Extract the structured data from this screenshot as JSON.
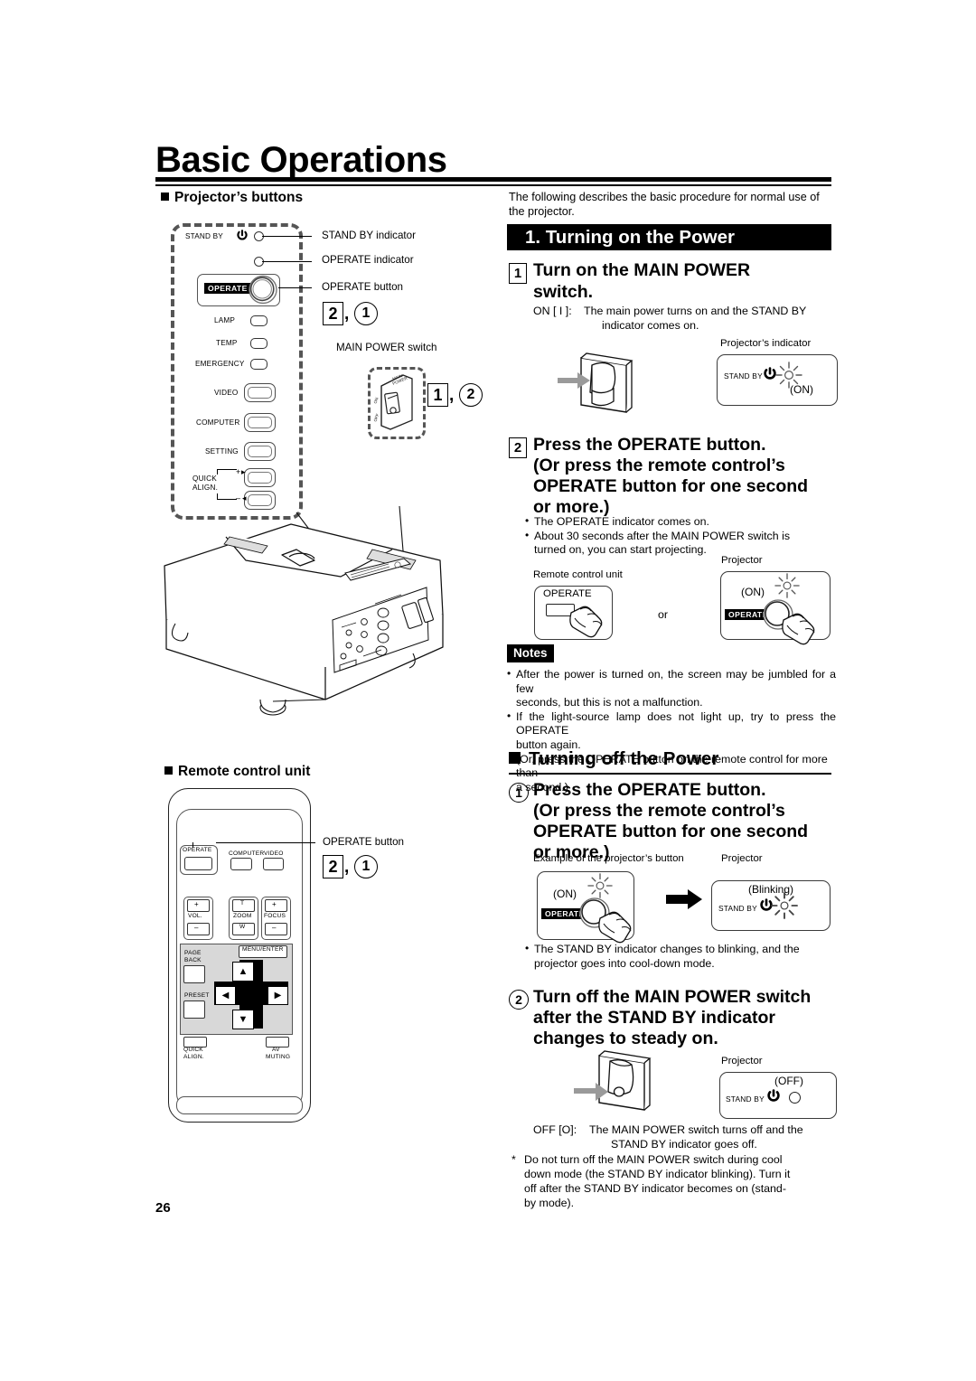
{
  "page": {
    "title": "Basic Operations",
    "number": "26"
  },
  "left_column": {
    "section1_heading": "Projector’s buttons",
    "callouts": {
      "standby_indicator": "STAND BY indicator",
      "operate_indicator": "OPERATE indicator",
      "operate_button": "OPERATE button",
      "main_power_switch": "MAIN POWER switch"
    },
    "panel": {
      "standby_label": "STAND BY",
      "operate_label": "OPERATE",
      "indicators": [
        "LAMP",
        "TEMP",
        "EMERGENCY"
      ],
      "source_buttons": [
        "VIDEO",
        "COMPUTER",
        "SETTING"
      ],
      "quick_align_label_line1": "QUICK",
      "quick_align_label_line2": "ALIGN.",
      "quick_align_plus": "+",
      "quick_align_minus": "–"
    },
    "step_marks": {
      "panel_operate": {
        "box": "2",
        "circle": "1"
      },
      "main_power": {
        "box": "1",
        "circle": "2"
      },
      "remote_operate": {
        "box": "2",
        "circle": "1"
      }
    },
    "main_power_switch_art": {
      "top_label": "MAIN POWER",
      "on_label": "ON",
      "off_label": "OFF"
    },
    "section2_heading": "Remote control unit",
    "remote": {
      "operate": "OPERATE",
      "computer": "COMPUTER",
      "video": "VIDEO",
      "vol": "VOL.",
      "vol_plus": "+",
      "vol_minus": "–",
      "zoom": "ZOOM",
      "zoom_t": "T",
      "zoom_w": "W",
      "focus": "FOCUS",
      "focus_plus": "+",
      "focus_minus": "–",
      "page_back_line1": "PAGE",
      "page_back_line2": "BACK",
      "menu_enter": "MENU/ENTER",
      "preset": "PRESET",
      "quick_align_line1": "QUICK",
      "quick_align_line2": "ALIGN.",
      "av_muting_line1": "AV",
      "av_muting_line2": "MUTING",
      "arrow_up": "▲",
      "arrow_down": "▼",
      "arrow_left": "◀",
      "arrow_right": "▶"
    },
    "remote_callout": "OPERATE button"
  },
  "right_column": {
    "intro_line1": "The following describes the basic procedure for normal use of",
    "intro_line2": "the projector.",
    "section_on": {
      "bar_title": "1. Turning on the Power",
      "step1": {
        "num": "1",
        "heading_line1": "Turn on the MAIN POWER",
        "heading_line2": "switch.",
        "desc_bold": "ON [ I ]:",
        "desc_line1": "The main power turns on and the STAND BY",
        "desc_line2": "indicator comes on."
      },
      "indicator_art": {
        "caption": "Projector’s indicator",
        "standby_label": "STAND BY",
        "state": "(ON)"
      },
      "step2": {
        "num": "2",
        "heading_line1": "Press the OPERATE button.",
        "heading_line2": "(Or press the remote control’s",
        "heading_line3": "OPERATE button for one second",
        "heading_line4": "or more.)",
        "bullet1": "The OPERATE indicator comes on.",
        "bullet2_line1": "About 30 seconds after the MAIN POWER switch is",
        "bullet2_line2": "turned on, you can start projecting."
      },
      "press_art": {
        "remote_caption": "Remote control unit",
        "remote_button": "OPERATE",
        "or": "or",
        "projector_caption": "Projector",
        "projector_state": "(ON)",
        "projector_button": "OPERATE"
      },
      "notes": {
        "tag": "Notes",
        "n1_line1": "After the power is turned on, the screen may be jumbled for a few",
        "n1_line2": "seconds, but this is not a malfunction.",
        "n2_line1": "If the light-source lamp does not light up, try to press the OPERATE",
        "n2_line2": "button again.",
        "n2_line3": "(Or, press the OPERATE button on the remote control for more than",
        "n2_line4": "a second.)"
      }
    },
    "section_off": {
      "heading": "Turning off the Power",
      "step1": {
        "num": "1",
        "heading_line1": "Press the OPERATE button.",
        "heading_line2": "(Or press the remote control’s",
        "heading_line3": "OPERATE button for one second",
        "heading_line4": "or more.)"
      },
      "art": {
        "caption_left": "Example of the projector’s button",
        "caption_right": "Projector",
        "left_state": "(ON)",
        "left_button": "OPERATE",
        "right_state": "(Blinking)",
        "right_standby": "STAND BY"
      },
      "bullet_line1": "The STAND BY indicator changes to blinking, and the",
      "bullet_line2": "projector goes into cool-down mode.",
      "step2": {
        "num": "2",
        "heading_line1": "Turn off the MAIN POWER switch",
        "heading_line2": "after the STAND BY indicator",
        "heading_line3": "changes to steady on."
      },
      "art2": {
        "caption": "Projector",
        "state": "(OFF)",
        "standby_label": "STAND BY"
      },
      "off_desc_bold": "OFF [O]:",
      "off_desc_line1": "The MAIN POWER switch turns off and the",
      "off_desc_line2": "STAND BY indicator goes off.",
      "star_line1": "Do not turn off the MAIN POWER switch during cool",
      "star_line2": "down mode (the STAND BY indicator blinking). Turn it",
      "star_line3": "off after the STAND BY indicator becomes on (stand-",
      "star_line4": "by mode).",
      "star": "*"
    }
  }
}
